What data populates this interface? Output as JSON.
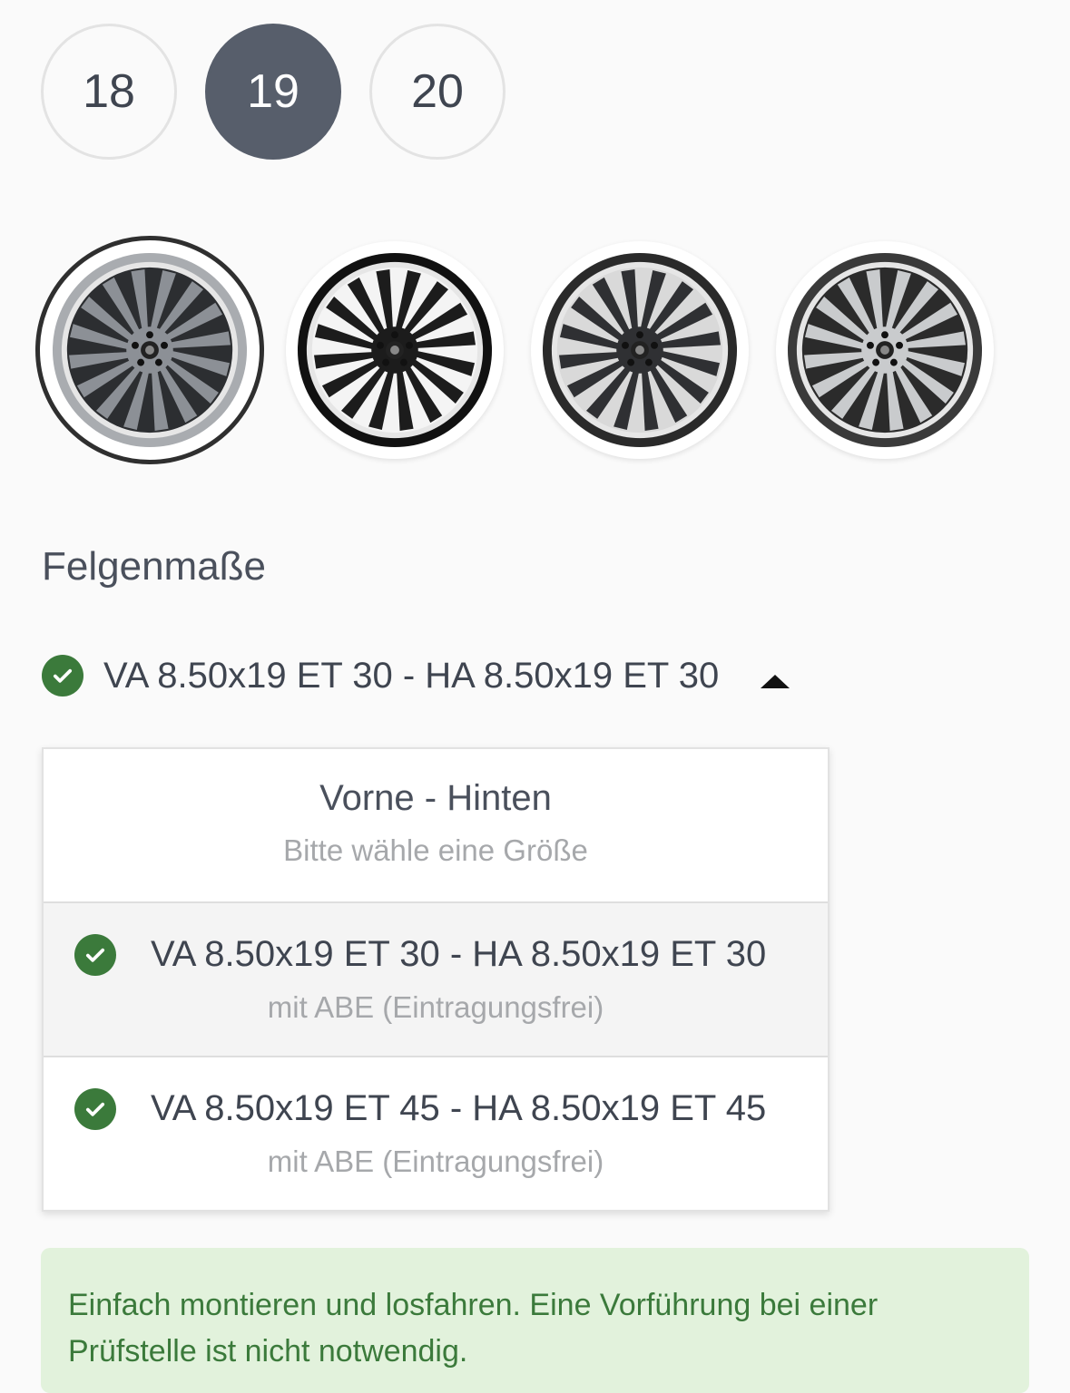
{
  "sizes": {
    "items": [
      {
        "label": "18",
        "active": false
      },
      {
        "label": "19",
        "active": true
      },
      {
        "label": "20",
        "active": false
      }
    ]
  },
  "colors": {
    "items": [
      {
        "name": "wheel-gunmetal",
        "rim": "#a9acb0",
        "spokes": "#8c9096",
        "gaps": "#2c2e31",
        "selected": true
      },
      {
        "name": "wheel-black",
        "rim": "#111111",
        "spokes": "#1c1c1c",
        "gaps": "#f4f4f4",
        "selected": false
      },
      {
        "name": "wheel-matt-black",
        "rim": "#2a2a2a",
        "spokes": "#2f3033",
        "gaps": "#d9d9d9",
        "selected": false
      },
      {
        "name": "wheel-black-polished",
        "rim": "#3a3a3a",
        "spokes": "#c9cbcd",
        "gaps": "#2b2b2b",
        "selected": false
      }
    ]
  },
  "section": {
    "title": "Felgenmaße"
  },
  "select": {
    "current": "VA 8.50x19 ET 30 - HA 8.50x19 ET 30",
    "header_title": "Vorne - Hinten",
    "header_subtitle": "Bitte wähle eine Größe",
    "options": [
      {
        "label": "VA 8.50x19 ET 30 - HA 8.50x19 ET 30",
        "note": "mit ABE (Eintragungsfrei)"
      },
      {
        "label": "VA 8.50x19 ET 45 - HA 8.50x19 ET 45",
        "note": "mit ABE (Eintragungsfrei)"
      }
    ]
  },
  "notice": {
    "text": "Einfach montieren und losfahren. Eine Vorführung bei einer Prüfstelle ist nicht notwendig."
  },
  "theme": {
    "accent_green": "#3b7a3b",
    "notice_bg": "#e2f2dc",
    "active_size_bg": "#575e6b"
  }
}
